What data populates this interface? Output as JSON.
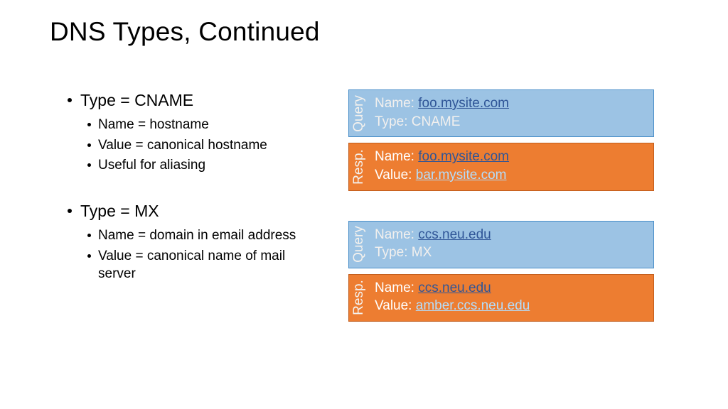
{
  "title": "DNS Types, Continued",
  "left": {
    "items": [
      {
        "label": "Type = CNAME",
        "sub": [
          "Name = hostname",
          "Value = canonical hostname",
          "Useful for aliasing"
        ]
      },
      {
        "label": "Type = MX",
        "sub": [
          "Name = domain in email address",
          "Value = canonical name of mail server"
        ]
      }
    ]
  },
  "right": {
    "group1": {
      "query": {
        "tab": "Query",
        "nameLabel": "Name: ",
        "nameLink": "foo.mysite.com",
        "typeLabel": "Type: CNAME"
      },
      "resp": {
        "tab": "Resp.",
        "nameLabel": "Name: ",
        "nameLink": "foo.mysite.com",
        "valueLabel": "Value: ",
        "valueLink": "bar.mysite.com"
      }
    },
    "group2": {
      "query": {
        "tab": "Query",
        "nameLabel": "Name: ",
        "nameLink": "ccs.neu.edu",
        "typeLabel": "Type: MX"
      },
      "resp": {
        "tab": "Resp.",
        "nameLabel": "Name: ",
        "nameLink": "ccs.neu.edu",
        "valueLabel": "Value: ",
        "valueLink": "amber.ccs.neu.edu"
      }
    }
  }
}
